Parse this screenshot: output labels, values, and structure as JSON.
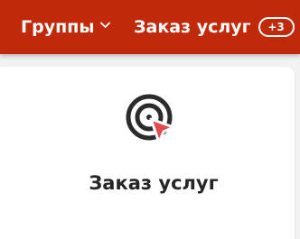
{
  "topbar": {
    "groups_label": "Группы",
    "orders_label": "Заказ услуг",
    "orders_badge": "+3"
  },
  "card": {
    "title": "Заказ услуг",
    "icon": "target-cursor-icon"
  },
  "colors": {
    "topbar_bg": "#c02a0a",
    "icon_dark": "#2b2b2b",
    "icon_accent": "#e5484d"
  }
}
